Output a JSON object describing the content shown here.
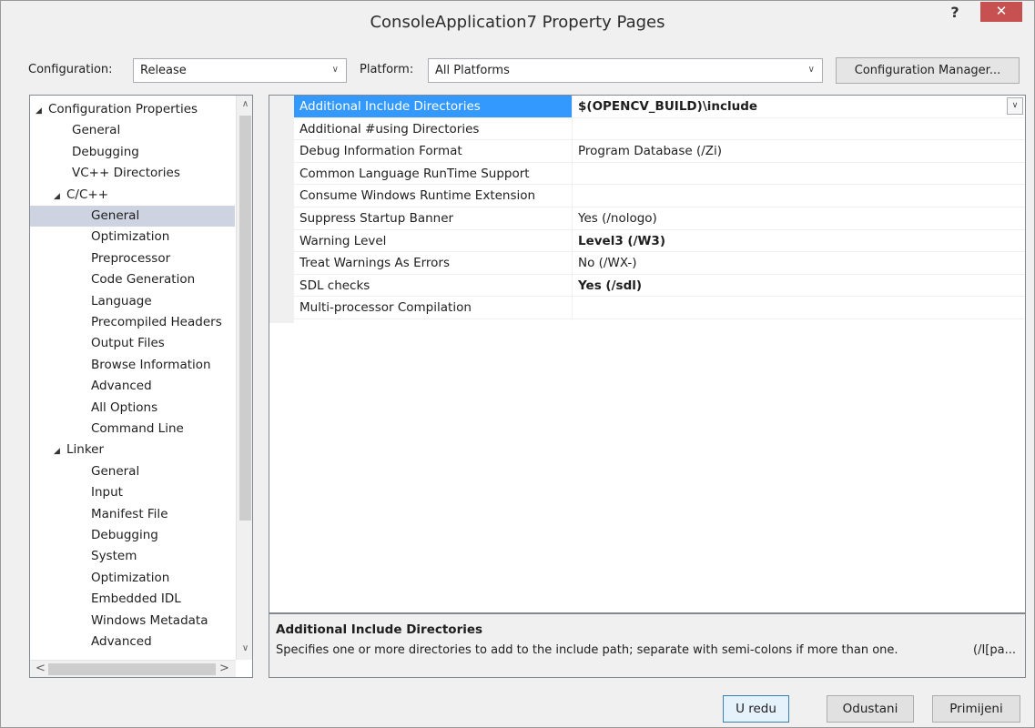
{
  "window": {
    "title": "ConsoleApplication7 Property Pages",
    "help": "?",
    "close": "✕"
  },
  "config_bar": {
    "configuration_label": "Configuration:",
    "configuration_value": "Release",
    "platform_label": "Platform:",
    "platform_value": "All Platforms",
    "manager_button": "Configuration Manager..."
  },
  "tree": {
    "items": [
      {
        "label": "Configuration Properties",
        "expanded": true
      },
      {
        "label": "General"
      },
      {
        "label": "Debugging"
      },
      {
        "label": "VC++ Directories"
      },
      {
        "label": "C/C++",
        "expanded": true
      },
      {
        "label": "General",
        "selected": true
      },
      {
        "label": "Optimization"
      },
      {
        "label": "Preprocessor"
      },
      {
        "label": "Code Generation"
      },
      {
        "label": "Language"
      },
      {
        "label": "Precompiled Headers"
      },
      {
        "label": "Output Files"
      },
      {
        "label": "Browse Information"
      },
      {
        "label": "Advanced"
      },
      {
        "label": "All Options"
      },
      {
        "label": "Command Line"
      },
      {
        "label": "Linker",
        "expanded": true
      },
      {
        "label": "General"
      },
      {
        "label": "Input"
      },
      {
        "label": "Manifest File"
      },
      {
        "label": "Debugging"
      },
      {
        "label": "System"
      },
      {
        "label": "Optimization"
      },
      {
        "label": "Embedded IDL"
      },
      {
        "label": "Windows Metadata"
      },
      {
        "label": "Advanced"
      }
    ]
  },
  "grid": {
    "rows": [
      {
        "name": "Additional Include Directories",
        "value": "$(OPENCV_BUILD)\\include",
        "bold": true,
        "selected": true
      },
      {
        "name": "Additional #using Directories",
        "value": ""
      },
      {
        "name": "Debug Information Format",
        "value": "Program Database (/Zi)"
      },
      {
        "name": "Common Language RunTime Support",
        "value": ""
      },
      {
        "name": "Consume Windows Runtime Extension",
        "value": ""
      },
      {
        "name": "Suppress Startup Banner",
        "value": "Yes (/nologo)"
      },
      {
        "name": "Warning Level",
        "value": "Level3 (/W3)",
        "bold": true
      },
      {
        "name": "Treat Warnings As Errors",
        "value": "No (/WX-)"
      },
      {
        "name": "SDL checks",
        "value": "Yes (/sdl)",
        "bold": true
      },
      {
        "name": "Multi-processor Compilation",
        "value": ""
      }
    ]
  },
  "description": {
    "title": "Additional Include Directories",
    "text": "Specifies one or more directories to add to the include path; separate with semi-colons if more than one.",
    "switch": "(/I[pa..."
  },
  "buttons": {
    "ok": "U redu",
    "cancel": "Odustani",
    "apply": "Primijeni"
  },
  "colors": {
    "selection": "#3399ff",
    "tree_selection": "#cdd3e0",
    "close": "#c75050"
  }
}
